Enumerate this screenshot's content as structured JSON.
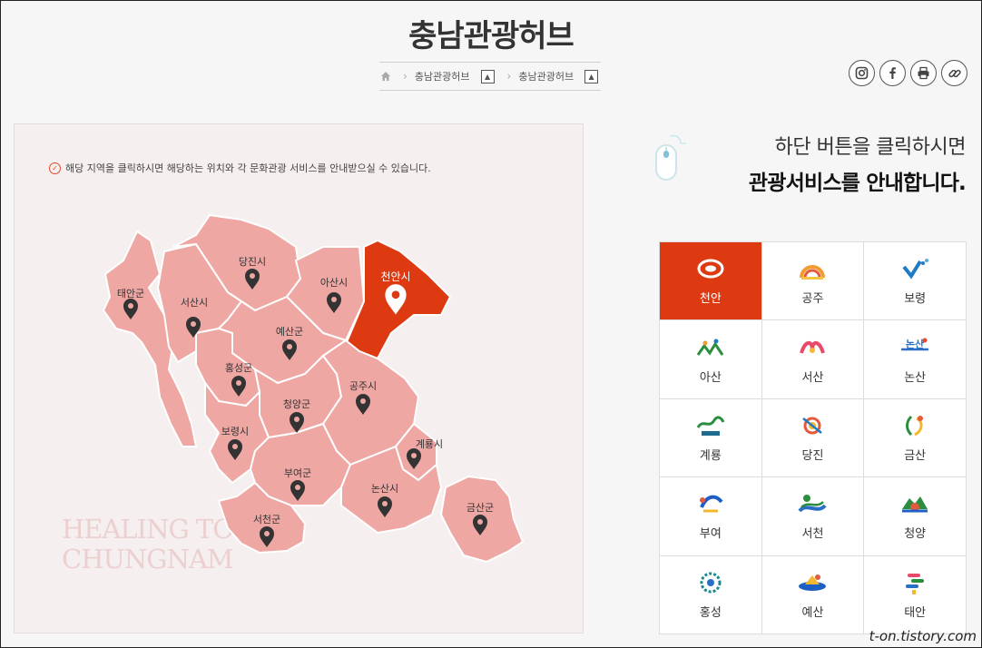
{
  "page": {
    "title": "충남관광허브",
    "breadcrumb": [
      "충남관광허브",
      "충남관광허브"
    ]
  },
  "share": [
    "instagram-icon",
    "facebook-icon",
    "print-icon",
    "link-icon"
  ],
  "map": {
    "notice": "해당 지역을 클릭하시면 해당하는 위치와 각 문화관광 서비스를 안내받으실 수 있습니다.",
    "watermark": [
      "HEALING TOUR",
      "CHUNGNAM"
    ],
    "regions": [
      {
        "id": "taean",
        "label": "태안군",
        "active": false
      },
      {
        "id": "seosan",
        "label": "서산시",
        "active": false
      },
      {
        "id": "dangjin",
        "label": "당진시",
        "active": false
      },
      {
        "id": "asan",
        "label": "아산시",
        "active": false
      },
      {
        "id": "cheonan",
        "label": "천안시",
        "active": true
      },
      {
        "id": "yesan",
        "label": "예산군",
        "active": false
      },
      {
        "id": "hongseong",
        "label": "홍성군",
        "active": false
      },
      {
        "id": "cheongyang",
        "label": "청양군",
        "active": false
      },
      {
        "id": "gongju",
        "label": "공주시",
        "active": false
      },
      {
        "id": "boryeong",
        "label": "보령시",
        "active": false
      },
      {
        "id": "gyeryong",
        "label": "계룡시",
        "active": false
      },
      {
        "id": "buyeo",
        "label": "부여군",
        "active": false
      },
      {
        "id": "nonsan",
        "label": "논산시",
        "active": false
      },
      {
        "id": "geumsan",
        "label": "금산군",
        "active": false
      },
      {
        "id": "seocheon",
        "label": "서천군",
        "active": false
      }
    ],
    "colors": {
      "region": "#efa7a4",
      "active": "#dd3a12",
      "border": "#ffffff"
    }
  },
  "guide": {
    "line1": "하단 버튼을 클릭하시면",
    "line2": "관광서비스를 안내합니다."
  },
  "services": [
    {
      "label": "천안",
      "icon": "cheonan-logo-icon",
      "active": true
    },
    {
      "label": "공주",
      "icon": "gongju-logo-icon",
      "active": false
    },
    {
      "label": "보령",
      "icon": "boryeong-logo-icon",
      "active": false
    },
    {
      "label": "아산",
      "icon": "asan-logo-icon",
      "active": false
    },
    {
      "label": "서산",
      "icon": "seosan-logo-icon",
      "active": false
    },
    {
      "label": "논산",
      "icon": "nonsan-logo-icon",
      "active": false
    },
    {
      "label": "계룡",
      "icon": "gyeryong-logo-icon",
      "active": false
    },
    {
      "label": "당진",
      "icon": "dangjin-logo-icon",
      "active": false
    },
    {
      "label": "금산",
      "icon": "geumsan-logo-icon",
      "active": false
    },
    {
      "label": "부여",
      "icon": "buyeo-logo-icon",
      "active": false
    },
    {
      "label": "서천",
      "icon": "seocheon-logo-icon",
      "active": false
    },
    {
      "label": "청양",
      "icon": "cheongyang-logo-icon",
      "active": false
    },
    {
      "label": "홍성",
      "icon": "hongseong-logo-icon",
      "active": false
    },
    {
      "label": "예산",
      "icon": "yesan-logo-icon",
      "active": false
    },
    {
      "label": "태안",
      "icon": "taean-logo-icon",
      "active": false
    }
  ],
  "credit": "t-on.tistory.com"
}
